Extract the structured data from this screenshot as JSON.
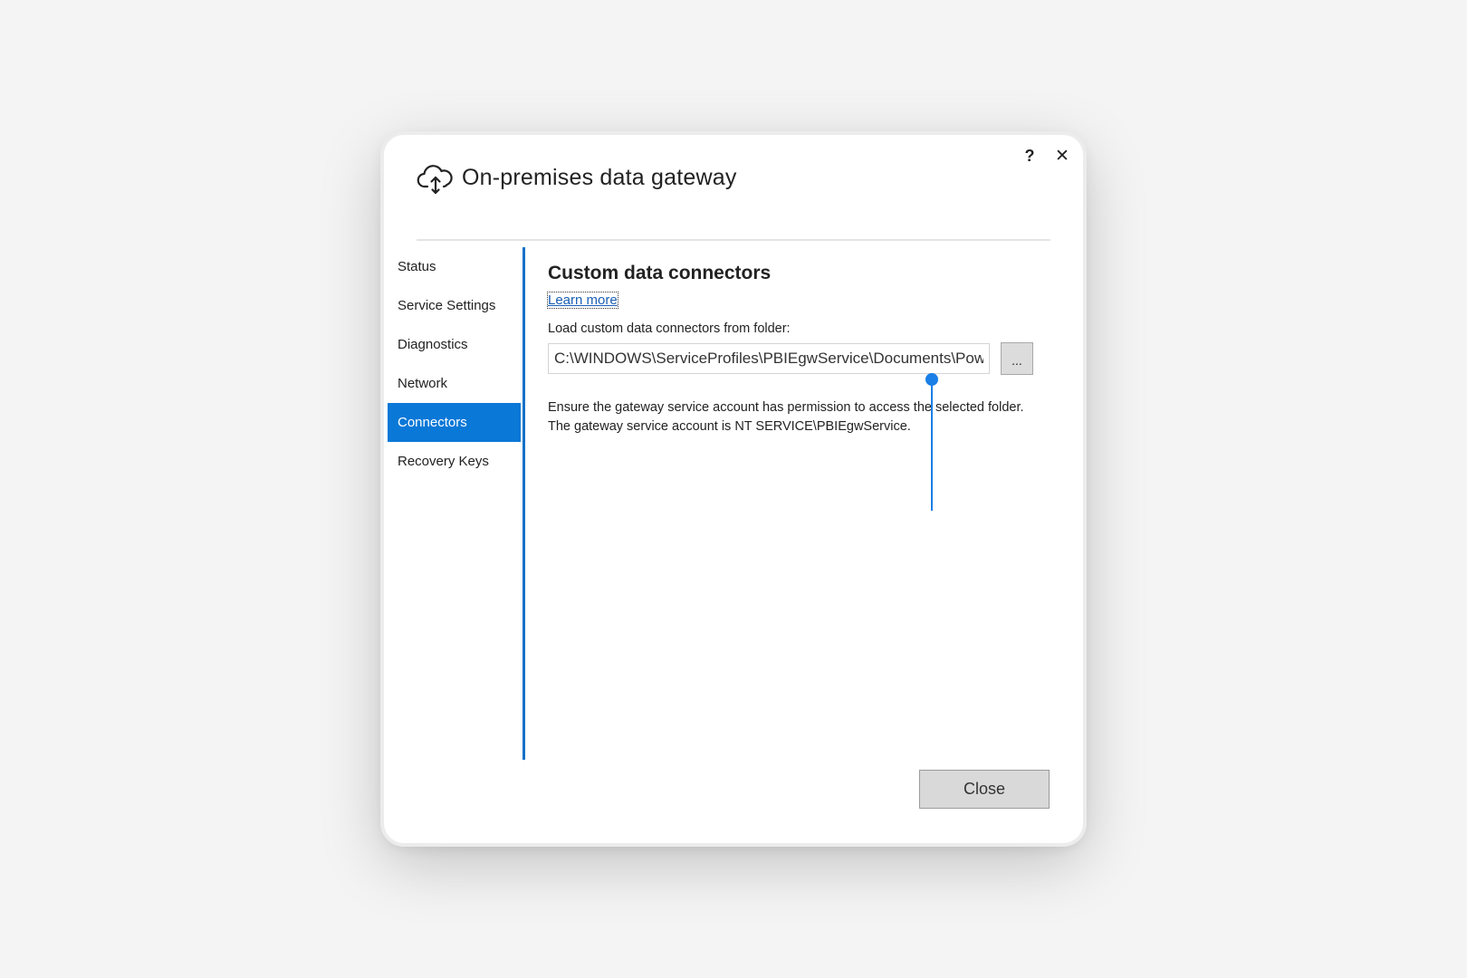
{
  "dialog": {
    "title": "On-premises data gateway",
    "icon": "cloud-upload-icon",
    "help_label": "?",
    "close_label": "✕"
  },
  "nav": {
    "items": [
      {
        "label": "Status",
        "active": false
      },
      {
        "label": "Service Settings",
        "active": false
      },
      {
        "label": "Diagnostics",
        "active": false
      },
      {
        "label": "Network",
        "active": false
      },
      {
        "label": "Connectors",
        "active": true
      },
      {
        "label": "Recovery Keys",
        "active": false
      }
    ]
  },
  "content": {
    "title": "Custom data connectors",
    "learn_more": "Learn more",
    "folder_label": "Load custom data connectors from folder:",
    "folder_path": "C:\\WINDOWS\\ServiceProfiles\\PBIEgwService\\Documents\\Power BI Desktop\\Custom Connectors",
    "browse_label": "...",
    "info_line1": "Ensure the gateway service account has permission to access the selected folder.",
    "info_line2": "The gateway service account is NT SERVICE\\PBIEgwService."
  },
  "footer": {
    "close_button": "Close"
  },
  "colors": {
    "accent": "#0a78d7",
    "divider": "#1572c7",
    "link": "#1a5fb4",
    "cursor": "#1a7fe6"
  }
}
